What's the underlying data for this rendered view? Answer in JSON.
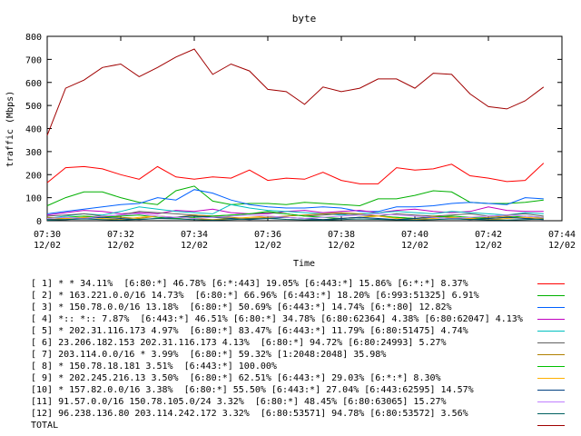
{
  "chart_data": {
    "type": "line",
    "title": "byte",
    "xlabel": "Time",
    "ylabel": "traffic (Mbps)",
    "xlim": [
      0,
      14
    ],
    "ylim": [
      0,
      800
    ],
    "yticks": [
      0,
      100,
      200,
      300,
      400,
      500,
      600,
      700,
      800
    ],
    "xticks": [
      {
        "x": 0,
        "time": "07:30",
        "date": "12/02"
      },
      {
        "x": 2,
        "time": "07:32",
        "date": "12/02"
      },
      {
        "x": 4,
        "time": "07:34",
        "date": "12/02"
      },
      {
        "x": 6,
        "time": "07:36",
        "date": "12/02"
      },
      {
        "x": 8,
        "time": "07:38",
        "date": "12/02"
      },
      {
        "x": 10,
        "time": "07:40",
        "date": "12/02"
      },
      {
        "x": 12,
        "time": "07:42",
        "date": "12/02"
      },
      {
        "x": 14,
        "time": "07:44",
        "date": "12/02"
      }
    ],
    "x": [
      0,
      0.5,
      1,
      1.5,
      2,
      2.5,
      3,
      3.5,
      4,
      4.5,
      5,
      5.5,
      6,
      6.5,
      7,
      7.5,
      8,
      8.5,
      9,
      9.5,
      10,
      10.5,
      11,
      11.5,
      12,
      12.5,
      13,
      13.5
    ],
    "series": [
      {
        "name": "[ 1] * * 34.11%  [6:80:*] 46.78% [6:*:443] 19.05% [6:443:*] 15.86% [6:*:*] 8.37%",
        "color": "#ff0000",
        "values": [
          165,
          230,
          235,
          225,
          200,
          180,
          235,
          190,
          180,
          190,
          185,
          220,
          175,
          185,
          180,
          210,
          175,
          160,
          160,
          230,
          220,
          225,
          245,
          195,
          185,
          170,
          175,
          250
        ]
      },
      {
        "name": "[ 2] * 163.221.0.0/16 14.73%  [6:80:*] 66.96% [6:443:*] 18.20% [6:993:51325] 6.91%",
        "color": "#00b000",
        "values": [
          65,
          100,
          125,
          125,
          100,
          80,
          70,
          130,
          150,
          85,
          70,
          75,
          75,
          70,
          80,
          75,
          70,
          65,
          95,
          95,
          110,
          130,
          125,
          80,
          75,
          75,
          80,
          90
        ]
      },
      {
        "name": "[ 3] * 150.78.0.0/16 13.18%  [6:80:*] 50.69% [6:443:*] 14.74% [6:*:80] 12.82%",
        "color": "#0060ff",
        "values": [
          30,
          40,
          50,
          60,
          70,
          75,
          100,
          90,
          135,
          120,
          90,
          70,
          60,
          55,
          55,
          60,
          55,
          40,
          40,
          60,
          60,
          65,
          75,
          80,
          75,
          70,
          100,
          95
        ]
      },
      {
        "name": "[ 4] *:: *:: 7.87%  [6:443:*] 46.51% [6:80:*] 34.78% [6:80:62364] 4.38% [6:80:62047] 4.13%",
        "color": "#c000c0",
        "values": [
          25,
          35,
          45,
          40,
          30,
          35,
          30,
          45,
          40,
          50,
          35,
          30,
          30,
          40,
          45,
          35,
          40,
          45,
          35,
          45,
          50,
          40,
          35,
          40,
          60,
          45,
          40,
          40
        ]
      },
      {
        "name": "[ 5] * 202.31.116.173 4.97%  [6:80:*] 83.47% [6:443:*] 11.79% [6:80:51475] 4.74%",
        "color": "#00c0c0",
        "values": [
          10,
          20,
          30,
          25,
          40,
          60,
          50,
          40,
          35,
          30,
          70,
          55,
          45,
          40,
          35,
          30,
          25,
          30,
          35,
          40,
          35,
          30,
          40,
          35,
          30,
          25,
          35,
          30
        ]
      },
      {
        "name": "[ 6] 23.206.182.153 202.31.116.173 4.13%  [6:80:*] 94.72% [6:80:24993] 5.27%",
        "color": "#606060",
        "values": [
          20,
          25,
          30,
          20,
          25,
          40,
          35,
          30,
          25,
          20,
          25,
          30,
          35,
          30,
          20,
          25,
          30,
          25,
          20,
          30,
          25,
          20,
          25,
          30,
          20,
          25,
          30,
          20
        ]
      },
      {
        "name": "[ 7] 203.114.0.0/16 * 3.99%  [6:80:*] 59.32% [1:2048:2048] 35.98%",
        "color": "#b08000",
        "values": [
          15,
          10,
          15,
          20,
          15,
          10,
          20,
          15,
          25,
          20,
          15,
          10,
          15,
          20,
          25,
          30,
          35,
          30,
          20,
          15,
          10,
          20,
          15,
          10,
          15,
          20,
          10,
          15
        ]
      },
      {
        "name": "[ 8] * 150.78.18.181 3.51%  [6:443:*] 100.00%",
        "color": "#00c000",
        "values": [
          10,
          15,
          20,
          15,
          20,
          25,
          15,
          10,
          15,
          20,
          25,
          30,
          40,
          30,
          20,
          15,
          10,
          15,
          20,
          15,
          10,
          15,
          20,
          15,
          10,
          15,
          20,
          15
        ]
      },
      {
        "name": "[ 9] * 202.245.216.13 3.50%  [6:80:*] 62.51% [6:443:*] 29.03% [6:*:*] 8.30%",
        "color": "#ffb000",
        "values": [
          5,
          10,
          15,
          10,
          5,
          15,
          20,
          15,
          10,
          5,
          10,
          15,
          20,
          15,
          10,
          5,
          10,
          15,
          20,
          10,
          5,
          10,
          15,
          10,
          5,
          10,
          15,
          10
        ]
      },
      {
        "name": "[10] * 157.82.0.0/16 3.38%  [6:80:*] 55.50% [6:443:*] 27.04% [6:443:62595] 14.57%",
        "color": "#004080",
        "values": [
          5,
          5,
          10,
          15,
          10,
          5,
          10,
          15,
          20,
          15,
          10,
          5,
          10,
          15,
          10,
          5,
          10,
          15,
          10,
          5,
          10,
          15,
          10,
          5,
          10,
          15,
          10,
          5
        ]
      },
      {
        "name": "[11] 91.57.0.0/16 150.78.105.0/24 3.32%  [6:80:*] 48.45% [6:80:63065] 15.27%",
        "color": "#c080ff",
        "values": [
          10,
          15,
          10,
          20,
          25,
          30,
          20,
          15,
          10,
          15,
          20,
          25,
          20,
          15,
          10,
          15,
          20,
          25,
          30,
          25,
          20,
          15,
          10,
          15,
          20,
          25,
          20,
          15
        ]
      },
      {
        "name": "[12] 96.238.136.80 203.114.242.172 3.32%  [6:80:53571] 94.78% [6:80:53572] 3.56%",
        "color": "#006060",
        "values": [
          2,
          5,
          8,
          5,
          3,
          6,
          10,
          8,
          5,
          3,
          5,
          8,
          10,
          6,
          4,
          3,
          5,
          8,
          6,
          4,
          3,
          5,
          8,
          6,
          4,
          3,
          5,
          8
        ]
      },
      {
        "name": "TOTAL",
        "color": "#a00000",
        "values": [
          370,
          575,
          610,
          665,
          680,
          625,
          665,
          710,
          745,
          635,
          680,
          650,
          570,
          560,
          505,
          580,
          560,
          575,
          615,
          615,
          575,
          640,
          635,
          550,
          495,
          485,
          520,
          580
        ]
      }
    ]
  }
}
